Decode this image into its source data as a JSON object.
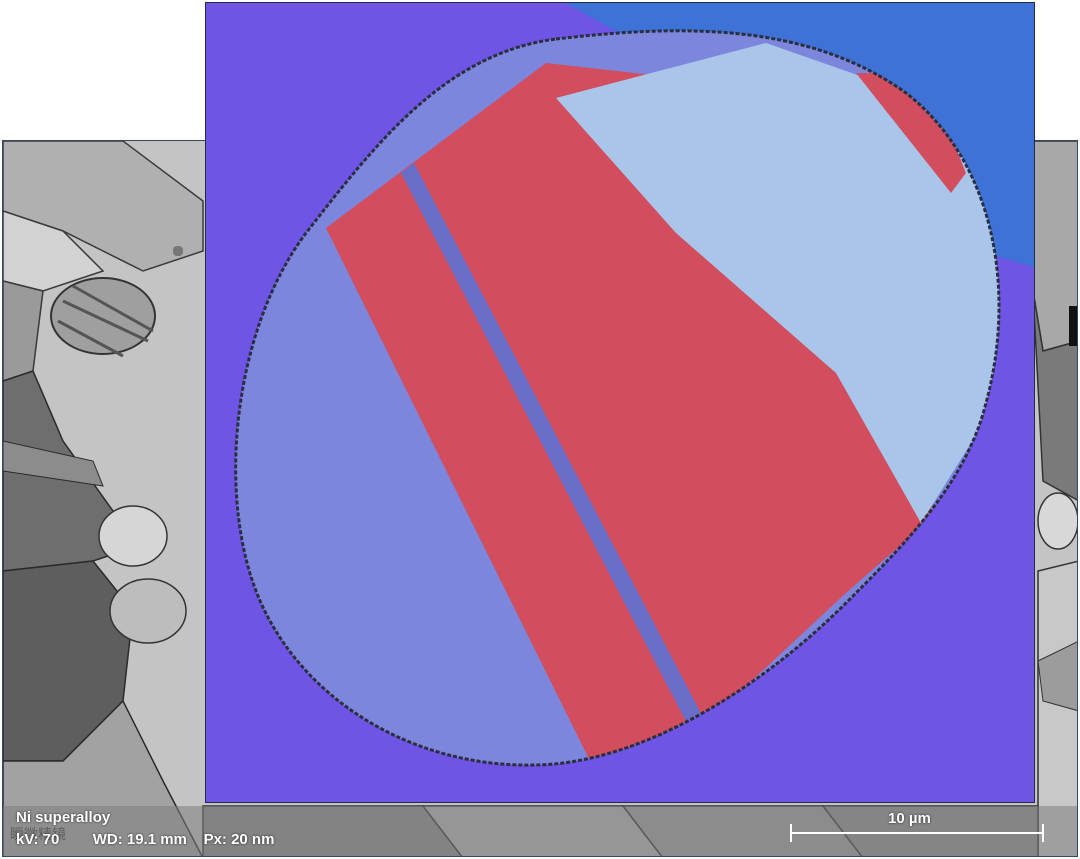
{
  "image": {
    "description": "SEM micrograph of a Ni superalloy grain structure with a color-coded orientation map overlay of a circular grain",
    "colors": {
      "matrix_purple": "#6f55e6",
      "grain_blue_top_right": "#3f72d6",
      "grain_light_blue": "#a9c6ea",
      "grain_red": "#d24e5e",
      "grain_slate_blue": "#7c86dc",
      "grayscale_background": "#b9b9b9"
    }
  },
  "caption": {
    "title": "Ni superalloy",
    "params": "kV: 70        WD: 19.1 mm    Px: 20 nm"
  },
  "scale_bar": {
    "label": "10 µm"
  },
  "watermark": "瞬微精镜"
}
